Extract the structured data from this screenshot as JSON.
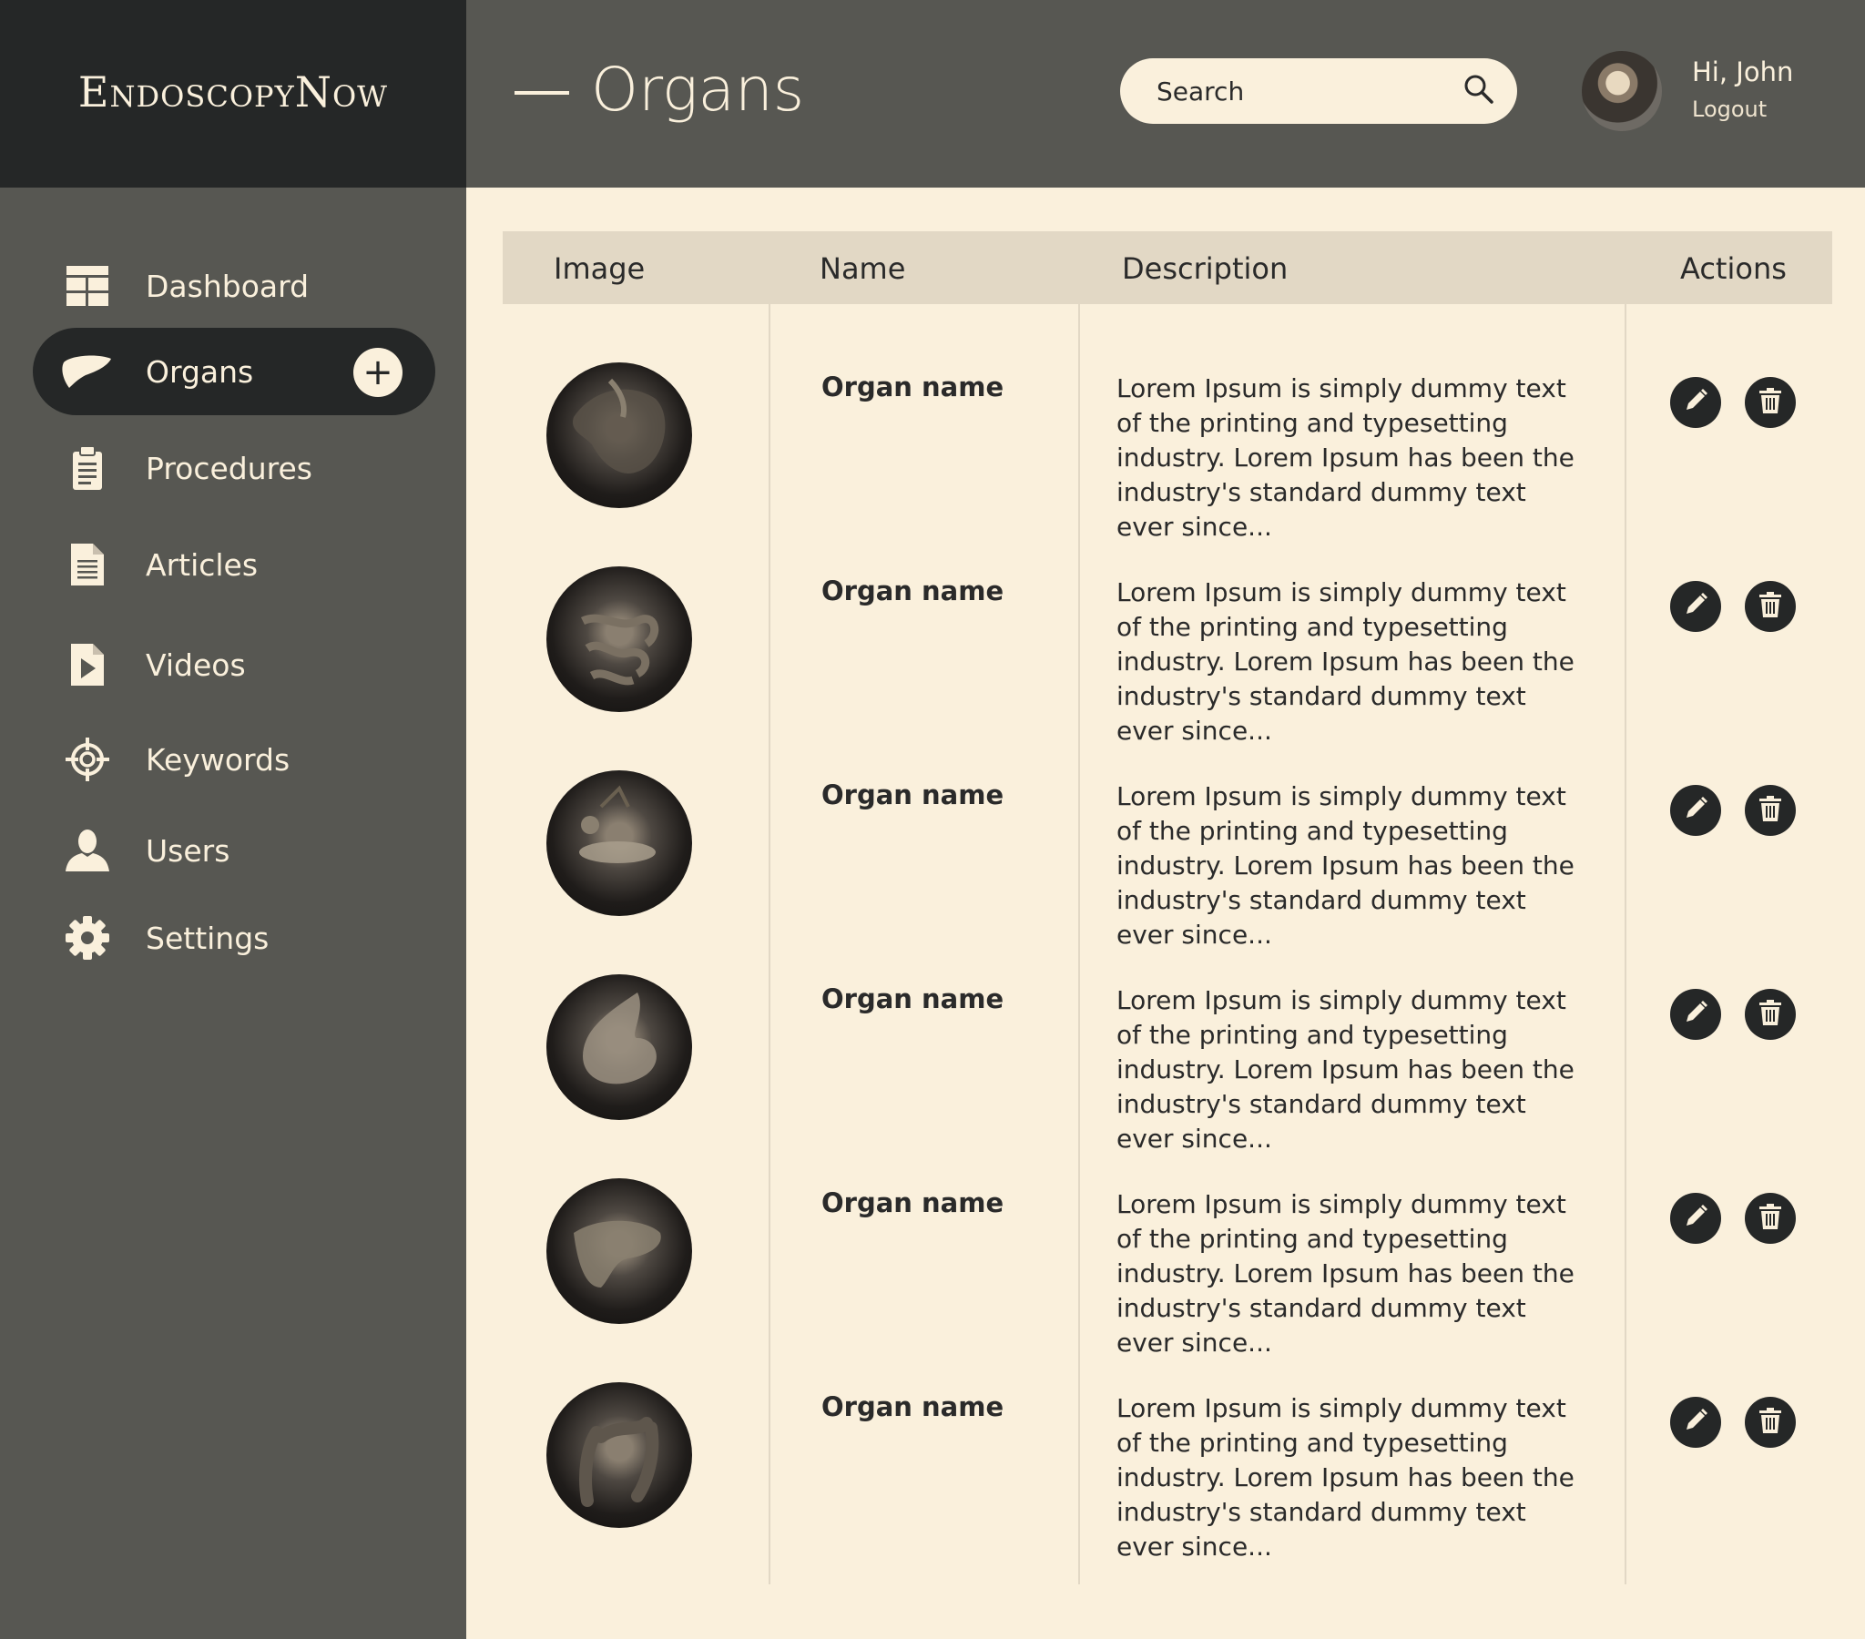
{
  "brand": {
    "logo_text": "EndoscopyNow"
  },
  "header": {
    "title": "Organs",
    "search_placeholder": "Search",
    "user_greeting": "Hi, John",
    "logout_label": "Logout"
  },
  "sidebar": {
    "items": [
      {
        "label": "Dashboard",
        "icon": "dashboard-grid-icon"
      },
      {
        "label": "Organs",
        "icon": "liver-icon",
        "active": true
      },
      {
        "label": "Procedures",
        "icon": "clipboard-icon"
      },
      {
        "label": "Articles",
        "icon": "document-icon"
      },
      {
        "label": "Videos",
        "icon": "video-file-icon"
      },
      {
        "label": "Keywords",
        "icon": "crosshair-icon"
      },
      {
        "label": "Users",
        "icon": "user-icon"
      },
      {
        "label": "Settings",
        "icon": "gear-icon"
      }
    ],
    "add_label": "+"
  },
  "table": {
    "headers": {
      "image": "Image",
      "name": "Name",
      "description": "Description",
      "actions": "Actions"
    },
    "rows": [
      {
        "name": "Organ name",
        "description": "Lorem Ipsum is simply dummy text of the printing and typesetting industry. Lorem Ipsum has been the industry's standard dummy text ever since..."
      },
      {
        "name": "Organ name",
        "description": "Lorem Ipsum is simply dummy text of the printing and typesetting industry. Lorem Ipsum has been the industry's standard dummy text ever since..."
      },
      {
        "name": "Organ name",
        "description": "Lorem Ipsum is simply dummy text of the printing and typesetting industry. Lorem Ipsum has been the industry's standard dummy text ever since..."
      },
      {
        "name": "Organ name",
        "description": "Lorem Ipsum is simply dummy text of the printing and typesetting industry. Lorem Ipsum has been the industry's standard dummy text ever since..."
      },
      {
        "name": "Organ name",
        "description": "Lorem Ipsum is simply dummy text of the printing and typesetting industry. Lorem Ipsum has been the industry's standard dummy text ever since..."
      },
      {
        "name": "Organ name",
        "description": "Lorem Ipsum is simply dummy text of the printing and typesetting industry. Lorem Ipsum has been the industry's standard dummy text ever since..."
      }
    ]
  },
  "colors": {
    "background": "#faf0dc",
    "sidebar": "#575752",
    "dark": "#252727",
    "table_header": "#e2d8c5"
  }
}
